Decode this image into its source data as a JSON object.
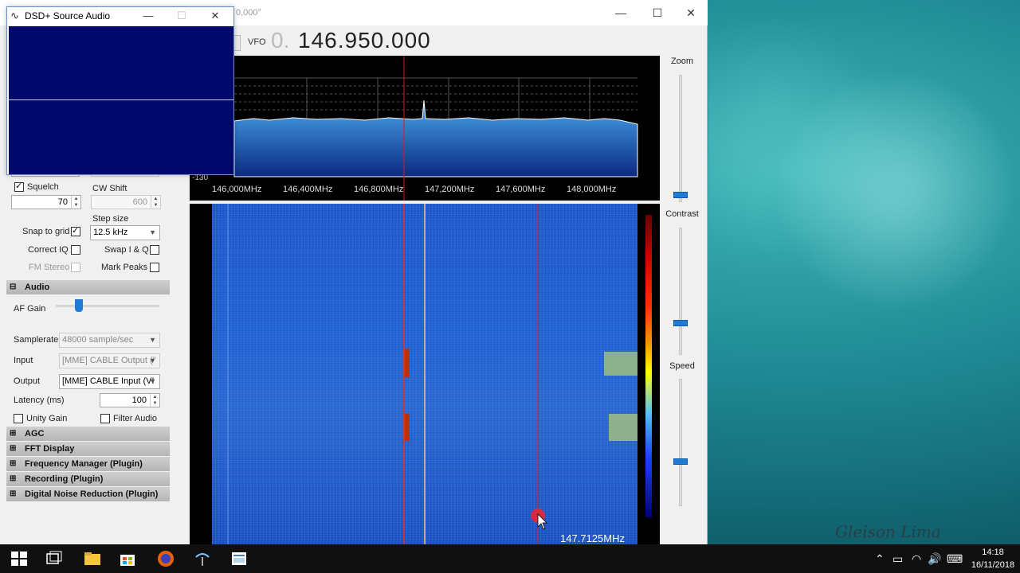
{
  "main_window": {
    "title": "0,000°"
  },
  "vfo": {
    "label": "VFO",
    "leading": "0.",
    "frequency": "146.950.000"
  },
  "spectrum": {
    "db_floor": "-130",
    "ticks": [
      "146,000MHz",
      "146,400MHz",
      "146,800MHz",
      "147,200MHz",
      "147,600MHz",
      "148,000MHz"
    ]
  },
  "waterfall": {
    "marker": "147.7125MHz"
  },
  "sliders": {
    "zoom": "Zoom",
    "contrast": "Contrast",
    "speed": "Speed"
  },
  "dsd": {
    "title": "DSD+ Source Audio"
  },
  "left_panel": {
    "squelch_label": "Squelch",
    "squelch_checked": true,
    "squelch_value": "70",
    "cw_shift_label": "CW Shift",
    "cw_shift_value": "600",
    "step_size_label": "Step size",
    "step_size_value": "12.5 kHz",
    "snap_to_grid": "Snap to grid",
    "correct_iq": "Correct IQ",
    "swap_iq": "Swap I & Q",
    "fm_stereo": "FM Stereo",
    "mark_peaks": "Mark Peaks"
  },
  "audio": {
    "header": "Audio",
    "af_gain": "AF Gain",
    "af_gain_level": 0.22,
    "samplerate_label": "Samplerate",
    "samplerate_value": "48000 sample/sec",
    "input_label": "Input",
    "input_value": "[MME] CABLE Output (\"",
    "output_label": "Output",
    "output_value": "[MME] CABLE Input (VI",
    "latency_label": "Latency (ms)",
    "latency_value": "100",
    "unity_gain": "Unity Gain",
    "filter_audio": "Filter Audio"
  },
  "sections": [
    "AGC",
    "FFT Display",
    "Frequency Manager (Plugin)",
    "Recording (Plugin)",
    "Digital Noise Reduction (Plugin)"
  ],
  "watermark": "Gleison Lima",
  "taskbar": {
    "time": "14:18",
    "date": "16/11/2018"
  }
}
